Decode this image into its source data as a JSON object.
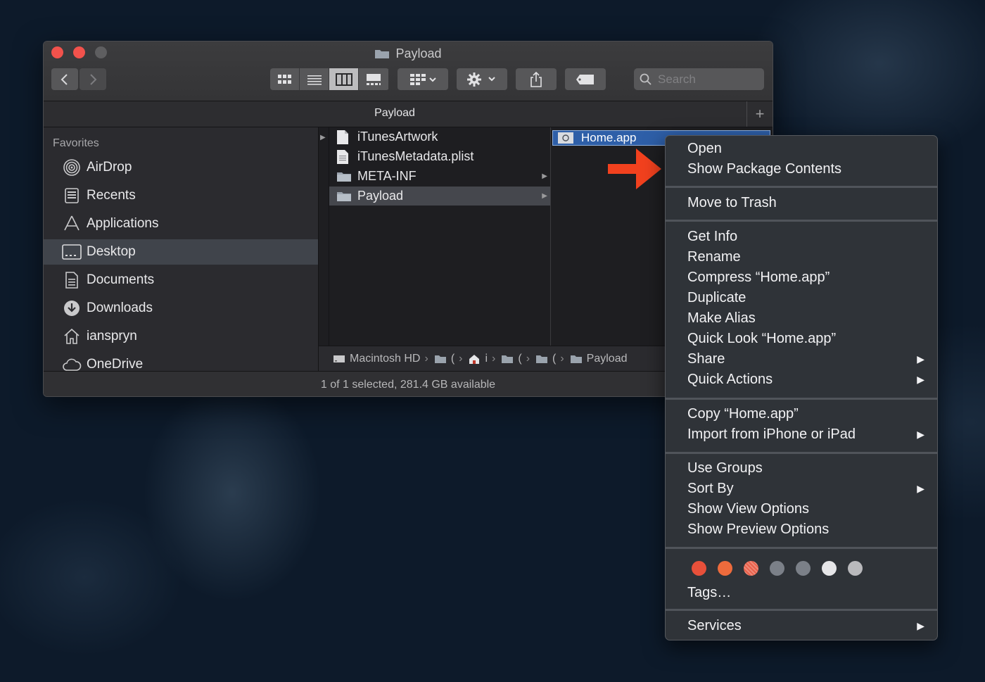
{
  "window": {
    "title": "Payload",
    "tab_title": "Payload",
    "tab_add": "+",
    "search_placeholder": "Search",
    "status": "1 of 1 selected, 281.4 GB available"
  },
  "sidebar": {
    "heading": "Favorites",
    "items": [
      {
        "label": "AirDrop",
        "icon": "airdrop-icon"
      },
      {
        "label": "Recents",
        "icon": "recents-icon"
      },
      {
        "label": "Applications",
        "icon": "applications-icon"
      },
      {
        "label": "Desktop",
        "icon": "desktop-icon",
        "selected": true
      },
      {
        "label": "Documents",
        "icon": "documents-icon"
      },
      {
        "label": "Downloads",
        "icon": "downloads-icon"
      },
      {
        "label": "ianspryn",
        "icon": "home-icon"
      },
      {
        "label": "OneDrive",
        "icon": "cloud-icon"
      }
    ]
  },
  "columns": {
    "col2": [
      {
        "label": "iTunesArtwork",
        "icon": "file-icon"
      },
      {
        "label": "iTunesMetadata.plist",
        "icon": "plist-file-icon"
      },
      {
        "label": "META-INF",
        "icon": "folder-icon",
        "has_children": true
      },
      {
        "label": "Payload",
        "icon": "folder-icon",
        "has_children": true,
        "selected": true
      }
    ],
    "col3_selected": "Home.app"
  },
  "pathbar": {
    "items": [
      "Macintosh HD",
      "(",
      "i",
      "(",
      "(",
      "Payload"
    ]
  },
  "context_menu": {
    "group1": [
      "Open",
      "Show Package Contents"
    ],
    "group2": [
      "Move to Trash"
    ],
    "group3": [
      "Get Info",
      "Rename",
      "Compress “Home.app”",
      "Duplicate",
      "Make Alias",
      "Quick Look “Home.app”",
      "Share",
      "Quick Actions"
    ],
    "group4": [
      "Copy “Home.app”",
      "Import from iPhone or iPad"
    ],
    "group5": [
      "Use Groups",
      "Sort By",
      "Show View Options",
      "Show Preview Options"
    ],
    "tags_label": "Tags…",
    "services": "Services",
    "submenu_arrow": "▶",
    "tag_colors": [
      "#e8503a",
      "#ee6b3c",
      "#e8604a",
      "#7b8088",
      "#7b8088",
      "#e6e6e8",
      "#b9b9bc"
    ]
  },
  "colors": {
    "accent_selection": "#2e5fa8",
    "annotation_arrow": "#f2411e",
    "close_button": "#f2524c"
  }
}
